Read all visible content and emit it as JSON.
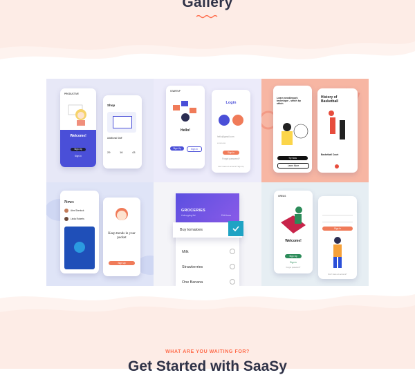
{
  "section": {
    "title": "Gallery"
  },
  "tiles": {
    "onboarding": {
      "brand": "PRODUCTIVE",
      "welcome": "Welcome!",
      "sign_up": "Sign Up",
      "sign_in": "Sign In",
      "shop_title": "Shop",
      "product_name": "Additional Stuff",
      "stats": [
        "29",
        "16",
        "43"
      ]
    },
    "login": {
      "brand": "STARTUP",
      "hello": "Hello!",
      "sign_up": "Sign Up",
      "sign_in": "Sign In",
      "login_title": "Login",
      "email_value": "hello@gmail.com",
      "password_value": "**********",
      "login_btn": "Sign In",
      "forgot": "Forgot password?",
      "no_account": "Don't have an account? Sign Up"
    },
    "learn": {
      "headline": "Learn needlework technique - stitch by stitch",
      "try_now": "Try Now",
      "learn_more": "Learn More",
      "history_title": "History of Basketball",
      "article": "Basketball Court"
    },
    "news": {
      "title": "News",
      "author1": "Alex Sherlock",
      "author2": "Linda Roberts",
      "keep_trends": "Keep trends in your pocket",
      "sign_up": "Sign Up"
    },
    "groceries": {
      "header": "GROCERIES",
      "subheader": "A shopping list",
      "edit": "Edit items",
      "items": [
        "Buy tomatoes",
        "Milk",
        "Strawberries",
        "One Banana"
      ]
    },
    "welcome2": {
      "brand": "GREUS",
      "welcome": "Welcome!",
      "sign_up": "Sign Up",
      "sign_in": "Sign in",
      "forgot": "Forgot password?",
      "login_btn": "Sign In",
      "no_account": "Don't have an account?"
    }
  },
  "cta": {
    "eyebrow": "WHAT ARE YOU WAITING FOR?",
    "heading": "Get Started with SaaSy"
  },
  "colors": {
    "heading": "#2f3247",
    "accent": "#ff6b4a",
    "band": "#fdece6"
  }
}
